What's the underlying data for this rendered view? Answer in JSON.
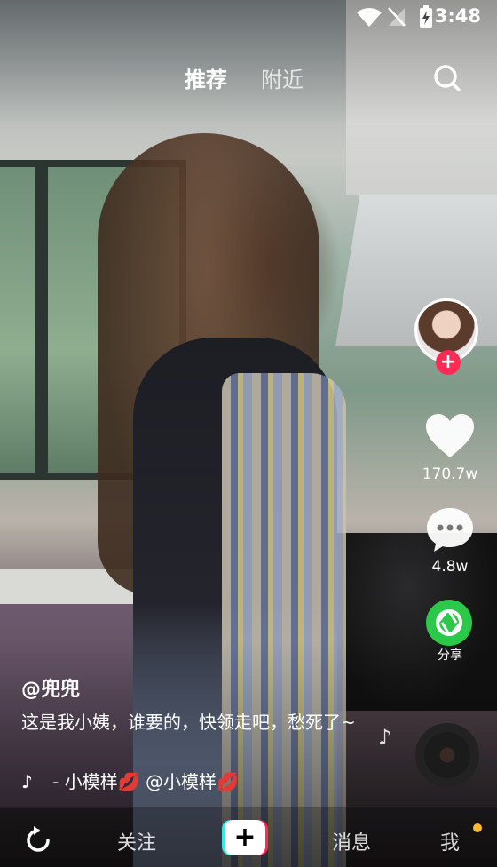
{
  "status_bar": {
    "time": "3:48"
  },
  "top_tabs": {
    "recommend": "推荐",
    "nearby": "附近"
  },
  "right_rail": {
    "follow_plus": "+",
    "likes": "170.7w",
    "comments": "4.8w",
    "share": "分享"
  },
  "caption": {
    "username": "@兜兜",
    "description": "这是我小姨，谁要的，快领走吧，愁死了~",
    "music": "- 小模样💋     @小模样💋"
  },
  "bottom_nav": {
    "follow": "关注",
    "create": "+",
    "messages": "消息",
    "me": "我"
  },
  "colors": {
    "like_red": "#fe2c55",
    "share_green": "#2bc84a",
    "badge_yellow": "#fdbb2b",
    "cyan": "#2af0ea"
  }
}
